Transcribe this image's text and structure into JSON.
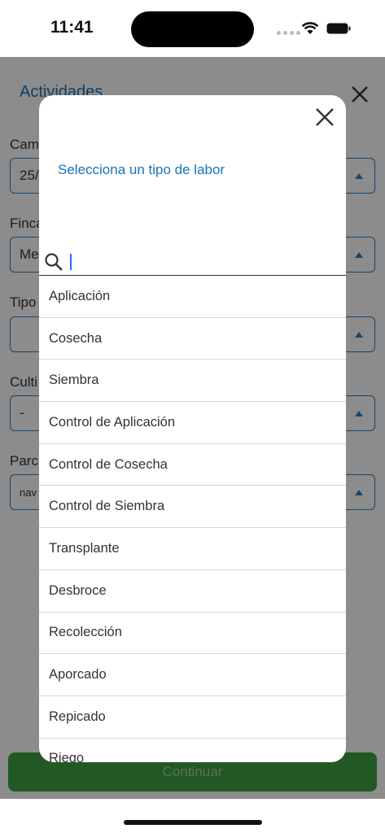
{
  "status_bar": {
    "time": "11:41"
  },
  "page": {
    "title": "Actividades",
    "fields": [
      {
        "label": "Cam",
        "value": "25/"
      },
      {
        "label": "Finca",
        "value": "Me"
      },
      {
        "label": "Tipo",
        "value": ""
      },
      {
        "label": "Culti",
        "value": "-"
      },
      {
        "label": "Parc",
        "value": "nav"
      }
    ],
    "continue_label": "Continuar"
  },
  "modal": {
    "title": "Selecciona un tipo de labor",
    "search": {
      "value": "",
      "placeholder": ""
    },
    "options": [
      "Aplicación",
      "Cosecha",
      "Siembra",
      "Control de Aplicación",
      "Control de Cosecha",
      "Control de Siembra",
      "Transplante",
      "Desbroce",
      "Recolección",
      "Aporcado",
      "Repicado",
      "Riego"
    ]
  },
  "colors": {
    "accent": "#1a73b8",
    "button_green": "#3fa142",
    "caret": "#2a6df4"
  }
}
